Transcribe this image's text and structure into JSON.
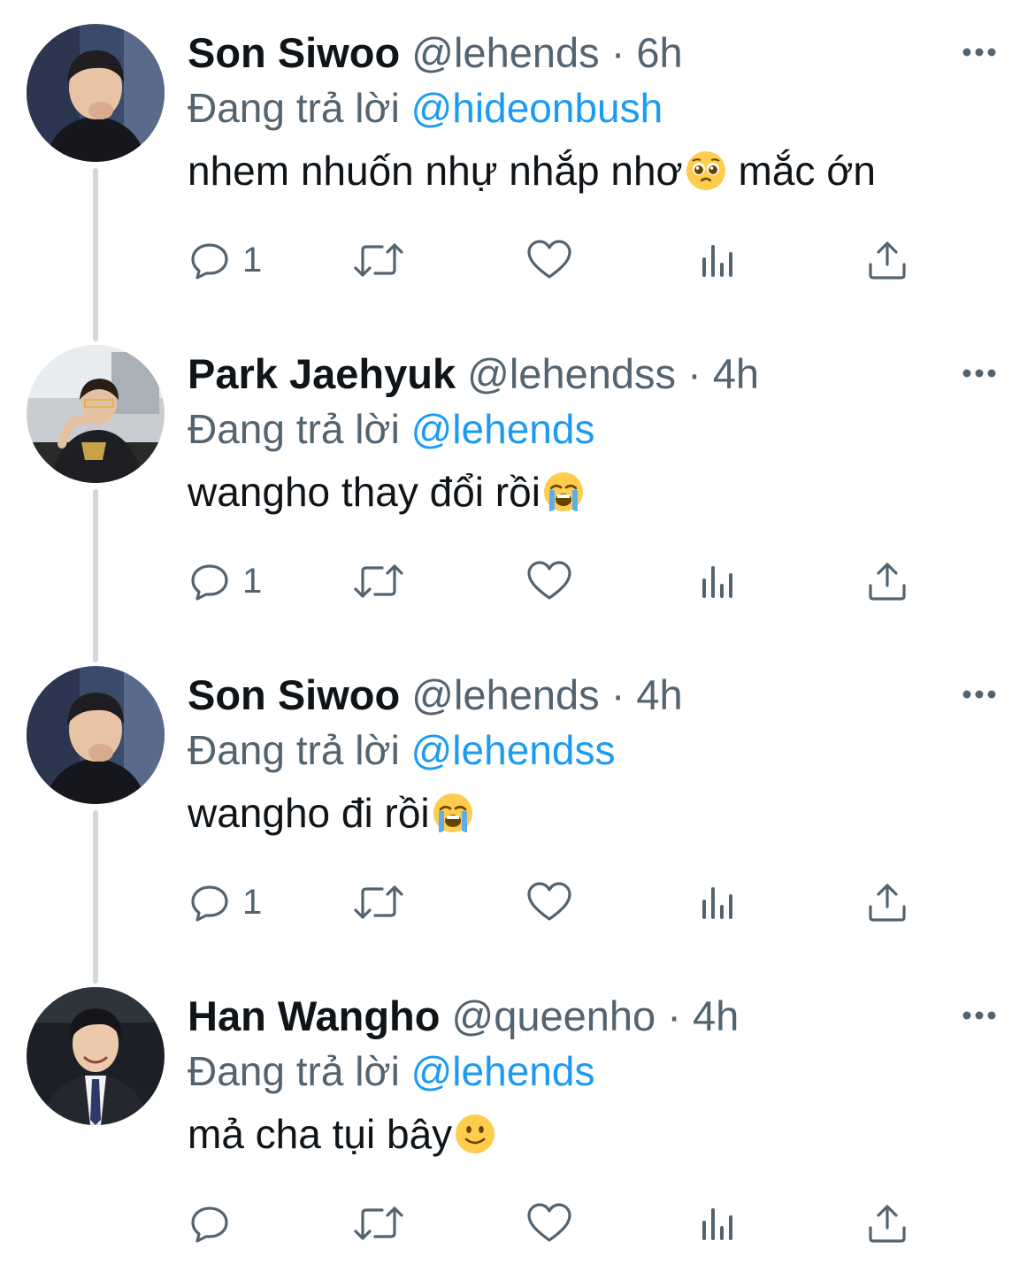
{
  "tweets": [
    {
      "name": "Son Siwoo",
      "handle": "@lehends",
      "separator": "·",
      "time": "6h",
      "reply_prefix": "Đang trả lời",
      "reply_to": "@hideonbush",
      "text_before": "nhem nhuốn nhự nhắp nhơ",
      "emoji": "pleading-face-emoji",
      "text_after": " mắc ớn",
      "reply_count": "1"
    },
    {
      "name": "Park Jaehyuk",
      "handle": "@lehendss",
      "separator": "·",
      "time": "4h",
      "reply_prefix": "Đang trả lời",
      "reply_to": "@lehends",
      "text_before": "wangho thay đổi rồi",
      "emoji": "loudly-crying-face-emoji",
      "text_after": "",
      "reply_count": "1"
    },
    {
      "name": "Son Siwoo",
      "handle": "@lehends",
      "separator": "·",
      "time": "4h",
      "reply_prefix": "Đang trả lời",
      "reply_to": "@lehendss",
      "text_before": "wangho đi rồi",
      "emoji": "loudly-crying-face-emoji",
      "text_after": "",
      "reply_count": "1"
    },
    {
      "name": "Han Wangho",
      "handle": "@queenho",
      "separator": "·",
      "time": "4h",
      "reply_prefix": "Đang trả lời",
      "reply_to": "@lehends",
      "text_before": "mả cha tụi bây",
      "emoji": "slightly-smiling-face-emoji",
      "text_after": "",
      "reply_count": ""
    }
  ],
  "colors": {
    "text": "#0f1419",
    "secondary": "#536471",
    "link": "#1d9bf0",
    "thread_line": "#cfd9de"
  },
  "icons": {
    "reply": "reply-icon",
    "retweet": "retweet-icon",
    "like": "heart-icon",
    "views": "views-icon",
    "share": "share-icon",
    "more": "more-icon"
  }
}
